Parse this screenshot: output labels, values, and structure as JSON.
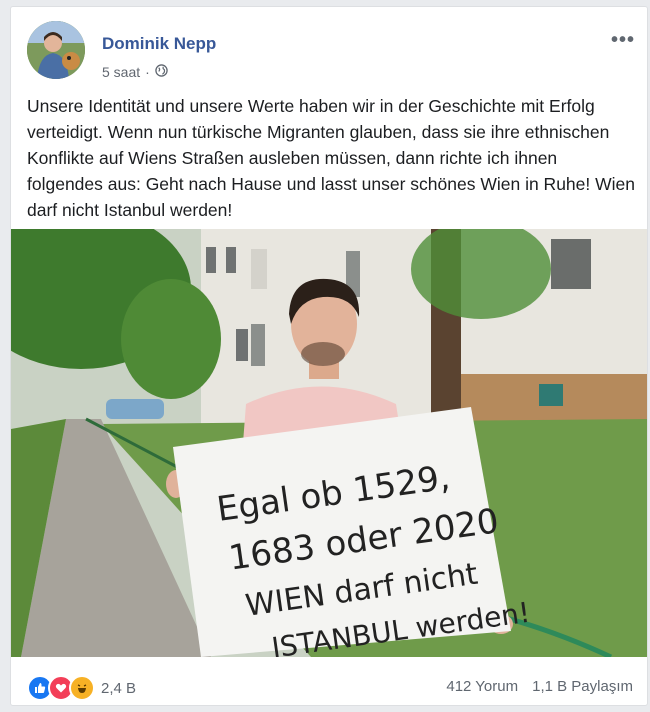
{
  "post": {
    "author": "Dominik Nepp",
    "time": "5 saat",
    "separator": "·",
    "text": "Unsere Identität und unsere Werte haben wir in der Geschichte mit Erfolg verteidigt. Wenn nun türkische Migranten glauben, dass sie ihre ethnischen Konflikte auf Wiens Straßen ausleben müssen, dann richte ich ihnen folgendes aus: Geht nach Hause und lasst unser schönes Wien in Ruhe! Wien darf nicht Istanbul werden!",
    "more_icon": "more-options-icon",
    "privacy_icon": "globe-icon"
  },
  "photo": {
    "sign_lines": [
      "Egal ob 1529,",
      "1683 oder 2020",
      "WIEN darf nicht",
      "ISTANBUL werden!"
    ]
  },
  "footer": {
    "reaction_count": "2,4 B",
    "reaction_icons": [
      "like-icon",
      "love-icon",
      "haha-icon"
    ],
    "comments": "412 Yorum",
    "shares": "1,1 B Paylaşım"
  },
  "colors": {
    "author": "#385898",
    "like": "#1877f2",
    "love": "#f33e58",
    "haha": "#f7b125"
  }
}
